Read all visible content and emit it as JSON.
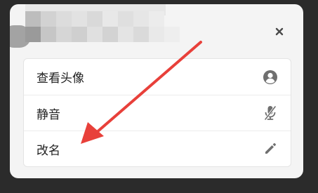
{
  "dialog": {
    "close_icon": "close-icon",
    "menu": [
      {
        "label": "查看头像",
        "icon": "avatar-icon"
      },
      {
        "label": "静音",
        "icon": "mic-off-icon"
      },
      {
        "label": "改名",
        "icon": "pencil-icon"
      }
    ]
  },
  "colors": {
    "annotation_arrow": "#e8403a",
    "background": "#2b2b2b",
    "dialog_bg": "#f4f4f4"
  }
}
